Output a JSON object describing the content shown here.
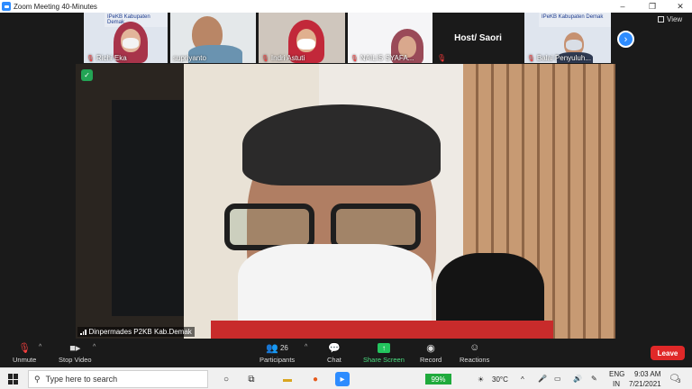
{
  "window": {
    "title": "Zoom Meeting 40-Minutes",
    "minimize": "–",
    "restore": "❐",
    "close": "✕"
  },
  "thumbnails": [
    {
      "name": "Richi Eka",
      "banner": "IPeKB Kabupaten Demak"
    },
    {
      "name": "supriyanto",
      "banner": ""
    },
    {
      "name": "Indri Astuti",
      "banner": ""
    },
    {
      "name": "NAILIS SYAFA...",
      "banner": ""
    },
    {
      "name": "Balai Penyuluh...",
      "banner": "IPeKB Kabupaten Demak"
    }
  ],
  "host_tile": {
    "label": "Host/ Saori"
  },
  "view_button": {
    "label": "View"
  },
  "next_button": {
    "glyph": "›"
  },
  "speaker": {
    "name": "Dinpermades P2KB Kab.Demak",
    "shield_glyph": "✓"
  },
  "controls": {
    "unmute": "Unmute",
    "stop_video": "Stop Video",
    "participants": "Participants",
    "participants_count": "26",
    "chat": "Chat",
    "share_screen": "Share Screen",
    "record": "Record",
    "reactions": "Reactions",
    "leave": "Leave"
  },
  "taskbar": {
    "search_placeholder": "Type here to search",
    "battery": "99%",
    "temperature": "30°C",
    "lang_line1": "ENG",
    "lang_line2": "IN",
    "time": "9:03 AM",
    "date": "7/21/2021",
    "notification_count": "3"
  },
  "colors": {
    "zoom_blue": "#2d8cff",
    "leave_red": "#e02828",
    "share_green": "#23c55e",
    "muted_red": "#ff3b3b"
  },
  "icons": {
    "unmute": "mic-muted-icon",
    "stop_video": "video-camera-icon",
    "participants": "people-icon",
    "chat": "chat-bubble-icon",
    "share_screen": "share-arrow-icon",
    "record": "record-circle-icon",
    "reactions": "smiley-plus-icon"
  }
}
